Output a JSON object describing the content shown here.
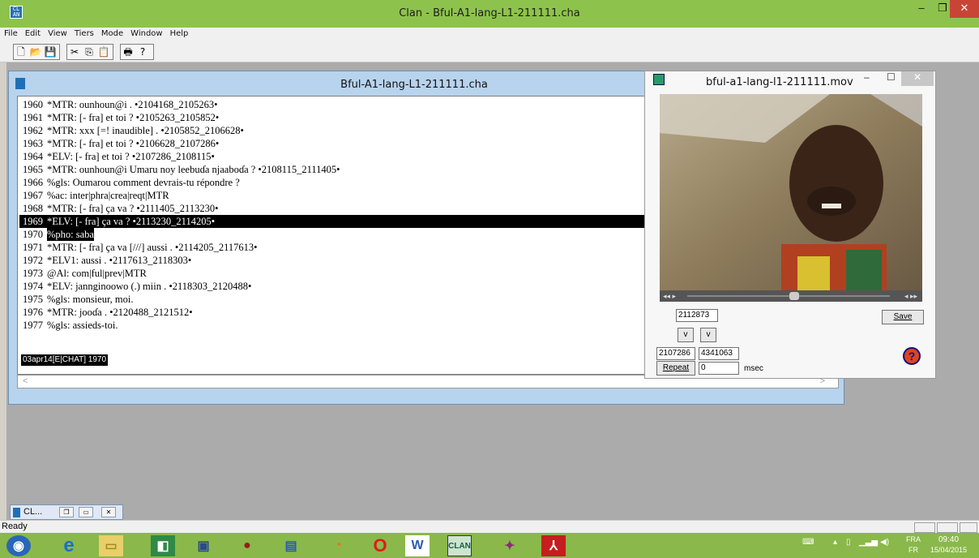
{
  "window": {
    "title": "Clan - Bful-A1-lang-L1-211111.cha",
    "min": "–",
    "max": "❐",
    "close": "✕"
  },
  "menu": [
    "File",
    "Edit",
    "View",
    "Tiers",
    "Mode",
    "Window",
    "Help"
  ],
  "toolbar": {
    "new": "🗋",
    "open": "📂",
    "save": "💾",
    "cut": "✂",
    "copy": "⎘",
    "paste": "📋",
    "print": "🖶",
    "help": "?"
  },
  "doc": {
    "title": "Bful-A1-lang-L1-211111.cha",
    "lines": [
      {
        "n": "1960",
        "t": "*MTR:  ounhoun@i . •2104168_2105263•"
      },
      {
        "n": "1961",
        "t": "*MTR:  [- fra] et toi ? •2105263_2105852•"
      },
      {
        "n": "1962",
        "t": "*MTR:  xxx [=! inaudible] . •2105852_2106628•"
      },
      {
        "n": "1963",
        "t": "*MTR:  [- fra] et toi ? •2106628_2107286•"
      },
      {
        "n": "1964",
        "t": "*ELV:  [- fra] et toi ? •2107286_2108115•"
      },
      {
        "n": "1965",
        "t": "*MTR:  ounhoun@i Umaru noy leebuɗa njaaboɗa ? •2108115_2111405•"
      },
      {
        "n": "1966",
        "t": "%gls:  Oumarou comment devrais-tu répondre ?"
      },
      {
        "n": "1967",
        "t": "%ac:   inter|phra|crea|reqt|MTR"
      },
      {
        "n": "1968",
        "t": "*MTR:  [- fra] ça va ? •2111405_2113230•"
      },
      {
        "n": "1969",
        "t": "*ELV:  [- fra] ça va ? •2113230_2114205•"
      },
      {
        "n": "1970",
        "t": "%pho:  saba"
      },
      {
        "n": "1971",
        "t": "*MTR:  [- fra] ça va [///] aussi . •2114205_2117613•"
      },
      {
        "n": "1972",
        "t": "*ELV1:  aussi . •2117613_2118303•"
      },
      {
        "n": "1973",
        "t": "@Al:   com|ful|prev|MTR"
      },
      {
        "n": "1974",
        "t": "*ELV:  jannginoowo (.) miin . •2118303_2120488•"
      },
      {
        "n": "1975",
        "t": "%gls:  monsieur, moi."
      },
      {
        "n": "1976",
        "t": "*MTR:  jooɗa . •2120488_2121512•"
      },
      {
        "n": "1977",
        "t": "%gls:  assieds-toi."
      }
    ],
    "mode_status": "03apr14[E|CHAT]   1970"
  },
  "movie": {
    "title": "bful-a1-lang-l1-211111.mov",
    "min": "–",
    "max": "☐",
    "close": "✕",
    "current_ms": "2112873",
    "save": "Save",
    "v1": "v",
    "v2": "v",
    "start_ms": "2107286",
    "end_ms": "4341063",
    "repeat": "Repeat",
    "repeat_val": "0",
    "unit": "msec",
    "help": "?"
  },
  "mini": {
    "label": "CL..."
  },
  "status": "Ready",
  "tray": {
    "lang": "FRA",
    "lang2": "FR",
    "time": "09:40",
    "date": "15/04/2015"
  },
  "colors": {
    "title_green": "#8dc34c",
    "taskbar_green": "#8ab84a",
    "doc_frame": "#b7d3ee"
  }
}
